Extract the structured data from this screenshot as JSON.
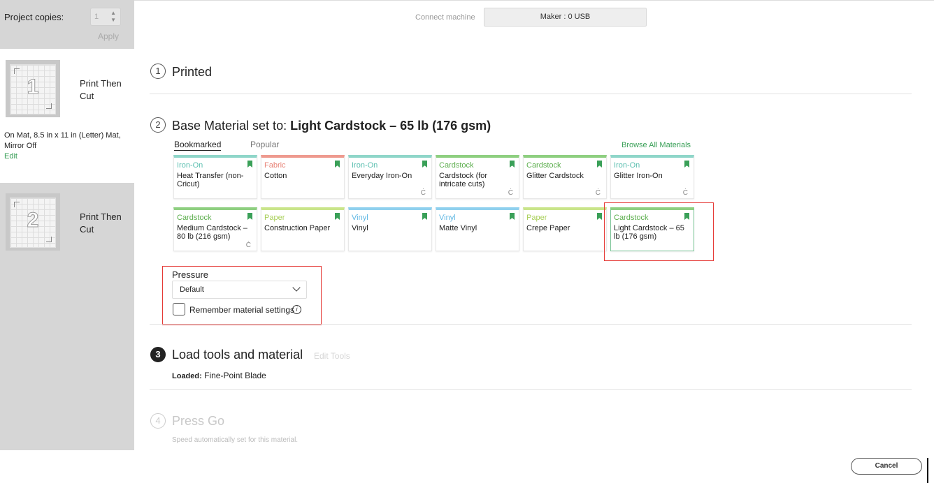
{
  "sidebar": {
    "project_copies_label": "Project copies:",
    "project_copies_value": "1",
    "apply_label": "Apply",
    "mats": [
      {
        "number": "1",
        "label": "Print Then Cut"
      },
      {
        "number": "2",
        "label": "Print Then Cut"
      }
    ],
    "mat_info": "On Mat, 8.5 in x 11 in (Letter) Mat, Mirror Off",
    "edit_label": "Edit"
  },
  "topbar": {
    "connect_label": "Connect machine",
    "machine_button": "Maker : 0 USB"
  },
  "steps": {
    "step1": {
      "number": "1",
      "title": "Printed"
    },
    "step2": {
      "number": "2",
      "title_prefix": "Base Material set to:",
      "title_material": "Light Cardstock – 65 lb (176 gsm)",
      "tabs": [
        "Bookmarked",
        "Popular"
      ],
      "browse_all": "Browse All Materials",
      "materials": [
        {
          "category": "Iron-On",
          "name": "Heat Transfer (non-Cricut)",
          "cricut": false,
          "color": "#8fd6c9"
        },
        {
          "category": "Fabric",
          "name": "Cotton",
          "cricut": false,
          "color": "#ee9a8f"
        },
        {
          "category": "Iron-On",
          "name": "Everyday Iron-On",
          "cricut": true,
          "color": "#8fd6c9"
        },
        {
          "category": "Cardstock",
          "name": "Cardstock (for intricate cuts)",
          "cricut": true,
          "color": "#8ecf80"
        },
        {
          "category": "Cardstock",
          "name": "Glitter Cardstock",
          "cricut": true,
          "color": "#8ecf80"
        },
        {
          "category": "Iron-On",
          "name": "Glitter Iron-On",
          "cricut": true,
          "color": "#8fd6c9"
        },
        {
          "category": "Cardstock",
          "name": "Medium Cardstock – 80 lb (216 gsm)",
          "cricut": true,
          "color": "#8ecf80"
        },
        {
          "category": "Paper",
          "name": "Construction Paper",
          "cricut": false,
          "color": "#c9e58a"
        },
        {
          "category": "Vinyl",
          "name": "Vinyl",
          "cricut": false,
          "color": "#8fd0ee"
        },
        {
          "category": "Vinyl",
          "name": "Matte Vinyl",
          "cricut": false,
          "color": "#8fd0ee"
        },
        {
          "category": "Paper",
          "name": "Crepe Paper",
          "cricut": false,
          "color": "#c9e58a"
        },
        {
          "category": "Cardstock",
          "name": "Light Cardstock – 65 lb (176 gsm)",
          "cricut": false,
          "color": "#8ecf80",
          "selected": true
        }
      ],
      "pressure_label": "Pressure",
      "pressure_value": "Default",
      "remember_label": "Remember material settings",
      "info_icon": "i"
    },
    "step3": {
      "number": "3",
      "title": "Load tools and material",
      "edit_tools": "Edit Tools",
      "loaded_key": "Loaded:",
      "loaded_value": "Fine-Point Blade"
    },
    "step4": {
      "number": "4",
      "title": "Press Go",
      "note": "Speed automatically set for this material."
    }
  },
  "footer": {
    "cancel_label": "Cancel"
  },
  "category_colors": {
    "Iron-On": "#5bbfb0",
    "Fabric": "#e88579",
    "Cardstock": "#5cae4d",
    "Paper": "#a8cf58",
    "Vinyl": "#5fb7e3"
  },
  "cricut_mark": "Ċ"
}
